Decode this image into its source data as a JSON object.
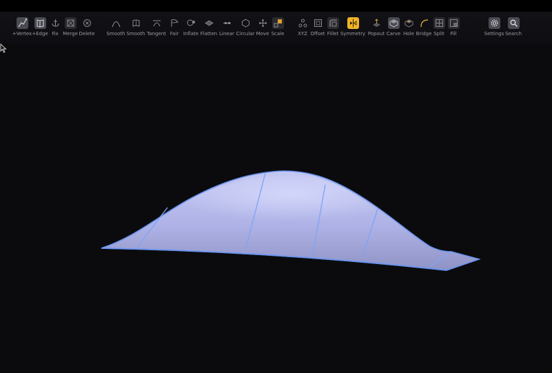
{
  "toolbar": {
    "tools": [
      {
        "label": "+Vertex",
        "icon": "add-vertex-icon",
        "state": "active"
      },
      {
        "label": "+Edge",
        "icon": "add-edge-icon",
        "state": "active"
      },
      {
        "label": "Fix",
        "icon": "anchor-icon",
        "state": "plain"
      },
      {
        "label": "Merge",
        "icon": "merge-icon",
        "state": "normal"
      },
      {
        "label": "Delete",
        "icon": "delete-icon",
        "state": "plain"
      },
      {
        "label": "Smooth",
        "icon": "smooth-curve-icon",
        "state": "plain"
      },
      {
        "label": "Smooth",
        "icon": "smooth-surface-icon",
        "state": "plain"
      },
      {
        "label": "Tangent",
        "icon": "tangent-icon",
        "state": "plain"
      },
      {
        "label": "Fair",
        "icon": "fair-icon",
        "state": "plain"
      },
      {
        "label": "Inflate",
        "icon": "inflate-icon",
        "state": "plain"
      },
      {
        "label": "Flatten",
        "icon": "flatten-icon",
        "state": "plain"
      },
      {
        "label": "Linear",
        "icon": "linear-icon",
        "state": "plain"
      },
      {
        "label": "Circular",
        "icon": "circular-icon",
        "state": "plain"
      },
      {
        "label": "Move",
        "icon": "move-icon",
        "state": "plain"
      },
      {
        "label": "Scale",
        "icon": "scale-icon",
        "state": "plain"
      },
      {
        "label": "XYZ",
        "icon": "xyz-icon",
        "state": "plain"
      },
      {
        "label": "Offset",
        "icon": "offset-icon",
        "state": "plain"
      },
      {
        "label": "Fillet",
        "icon": "fillet-icon",
        "state": "plain"
      },
      {
        "label": "Symmetry",
        "icon": "symmetry-icon",
        "state": "accent"
      },
      {
        "label": "Popout",
        "icon": "popout-icon",
        "state": "plain"
      },
      {
        "label": "Carve",
        "icon": "carve-icon",
        "state": "active"
      },
      {
        "label": "Hole",
        "icon": "hole-icon",
        "state": "plain"
      },
      {
        "label": "Bridge",
        "icon": "bridge-icon",
        "state": "plain"
      },
      {
        "label": "Split",
        "icon": "split-icon",
        "state": "plain"
      },
      {
        "label": "Fill",
        "icon": "fill-icon",
        "state": "plain"
      },
      {
        "label": "Settings",
        "icon": "gear-icon",
        "state": "active"
      },
      {
        "label": "Search",
        "icon": "search-icon",
        "state": "active"
      }
    ]
  },
  "colors": {
    "background": "#0b0b0e",
    "toolbar": "#121216",
    "label": "#9a9aa2",
    "accent": "#f0b429",
    "surface_edge": "#6a95f0",
    "surface_fill": "#b8bdf0"
  }
}
